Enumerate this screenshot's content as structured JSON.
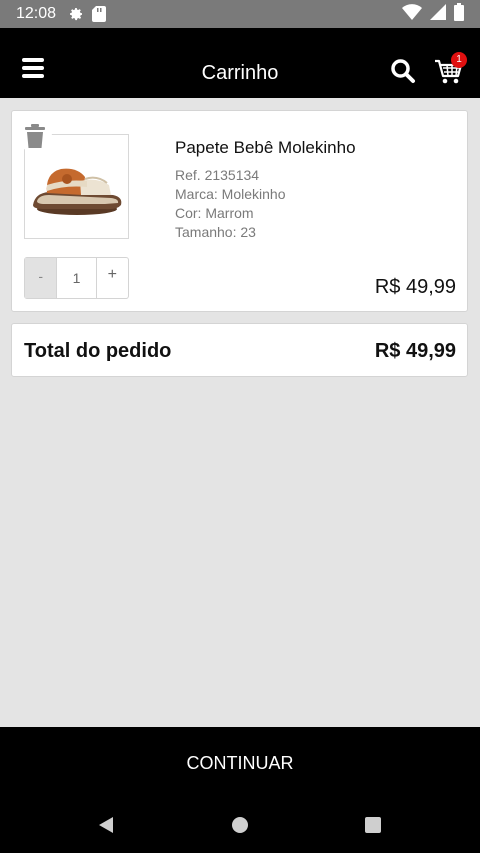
{
  "status_bar": {
    "time": "12:08"
  },
  "app_bar": {
    "title": "Carrinho",
    "cart_count": "1"
  },
  "cart_item": {
    "name": "Papete Bebê Molekinho",
    "ref": "Ref. 2135134",
    "brand": "Marca: Molekinho",
    "color": "Cor: Marrom",
    "size": "Tamanho: 23",
    "quantity": "1",
    "minus_label": "-",
    "plus_label": "+",
    "price": "R$ 49,99"
  },
  "summary": {
    "label": "Total do pedido",
    "value": "R$ 49,99"
  },
  "footer": {
    "continue_label": "CONTINUAR"
  },
  "colors": {
    "background": "#e4e4e4",
    "app_bar": "#000000",
    "badge": "#e01010",
    "status_bar": "#7a7a7a"
  },
  "icons": {
    "menu": "menu-icon",
    "search": "search-icon",
    "cart": "cart-icon",
    "trash": "trash-icon",
    "back": "back-icon",
    "home": "home-icon",
    "recents": "recents-icon"
  }
}
